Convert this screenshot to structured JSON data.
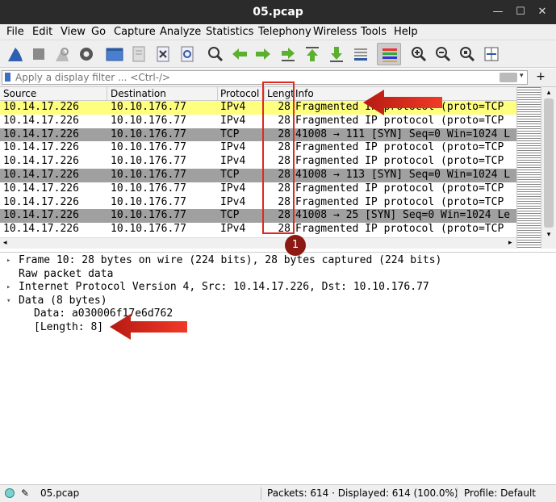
{
  "window": {
    "title": "05.pcap"
  },
  "menu": [
    "File",
    "Edit",
    "View",
    "Go",
    "Capture",
    "Analyze",
    "Statistics",
    "Telephony",
    "Wireless",
    "Tools",
    "Help"
  ],
  "toolbar_icons": [
    "shark-fin-start-icon",
    "stop-icon",
    "restart-icon",
    "options-gear-icon",
    "open-folder-icon",
    "save-file-icon",
    "close-file-icon",
    "reload-icon",
    "find-packet-icon",
    "go-back-icon",
    "go-forward-icon",
    "go-to-packet-icon",
    "go-first-icon",
    "go-last-icon",
    "autoscroll-icon",
    "colorize-icon",
    "zoom-in-icon",
    "zoom-out-icon",
    "zoom-normal-icon",
    "resize-columns-icon"
  ],
  "filter": {
    "placeholder": "Apply a display filter ... <Ctrl-/>"
  },
  "columns": [
    "Source",
    "Destination",
    "Protocol",
    "Lengt",
    "Info"
  ],
  "packets": [
    {
      "src": "10.14.17.226",
      "dst": "10.10.176.77",
      "proto": "IPv4",
      "len": "28",
      "info": "Fragmented IP protocol (proto=TCP",
      "style": "yellow"
    },
    {
      "src": "10.14.17.226",
      "dst": "10.10.176.77",
      "proto": "IPv4",
      "len": "28",
      "info": "Fragmented IP protocol (proto=TCP",
      "style": "white"
    },
    {
      "src": "10.14.17.226",
      "dst": "10.10.176.77",
      "proto": "TCP",
      "len": "28",
      "info": "41008 → 111 [SYN] Seq=0 Win=1024 L",
      "style": "gray"
    },
    {
      "src": "10.14.17.226",
      "dst": "10.10.176.77",
      "proto": "IPv4",
      "len": "28",
      "info": "Fragmented IP protocol (proto=TCP",
      "style": "white"
    },
    {
      "src": "10.14.17.226",
      "dst": "10.10.176.77",
      "proto": "IPv4",
      "len": "28",
      "info": "Fragmented IP protocol (proto=TCP",
      "style": "white"
    },
    {
      "src": "10.14.17.226",
      "dst": "10.10.176.77",
      "proto": "TCP",
      "len": "28",
      "info": "41008 → 113 [SYN] Seq=0 Win=1024 L",
      "style": "gray"
    },
    {
      "src": "10.14.17.226",
      "dst": "10.10.176.77",
      "proto": "IPv4",
      "len": "28",
      "info": "Fragmented IP protocol (proto=TCP",
      "style": "white"
    },
    {
      "src": "10.14.17.226",
      "dst": "10.10.176.77",
      "proto": "IPv4",
      "len": "28",
      "info": "Fragmented IP protocol (proto=TCP",
      "style": "white"
    },
    {
      "src": "10.14.17.226",
      "dst": "10.10.176.77",
      "proto": "TCP",
      "len": "28",
      "info": "41008 → 25 [SYN] Seq=0 Win=1024 Le",
      "style": "gray"
    },
    {
      "src": "10.14.17.226",
      "dst": "10.10.176.77",
      "proto": "IPv4",
      "len": "28",
      "info": "Fragmented IP protocol (proto=TCP",
      "style": "white"
    }
  ],
  "details": [
    {
      "text": "Frame 10: 28 bytes on wire (224 bits), 28 bytes captured (224 bits)",
      "expander": "collapsed",
      "indent": 0
    },
    {
      "text": "Raw packet data",
      "expander": "none",
      "indent": 0
    },
    {
      "text": "Internet Protocol Version 4, Src: 10.14.17.226, Dst: 10.10.176.77",
      "expander": "collapsed",
      "indent": 0
    },
    {
      "text": "Data (8 bytes)",
      "expander": "expanded",
      "indent": 0
    },
    {
      "text": "Data: a030006f17e6d762",
      "expander": "none",
      "indent": 1
    },
    {
      "text": "[Length: 8]",
      "expander": "none",
      "indent": 1
    }
  ],
  "status": {
    "file": "05.pcap",
    "packets": "Packets: 614 · Displayed: 614 (100.0%)",
    "profile": "Profile: Default"
  },
  "annotation": {
    "badge": "1",
    "color": "#e0281f",
    "badge_color": "#8c1a13"
  },
  "colors": {
    "selected_row": "#ffff7f",
    "tcp_row": "#a0a0a0",
    "titlebar": "#2b2b2b"
  }
}
